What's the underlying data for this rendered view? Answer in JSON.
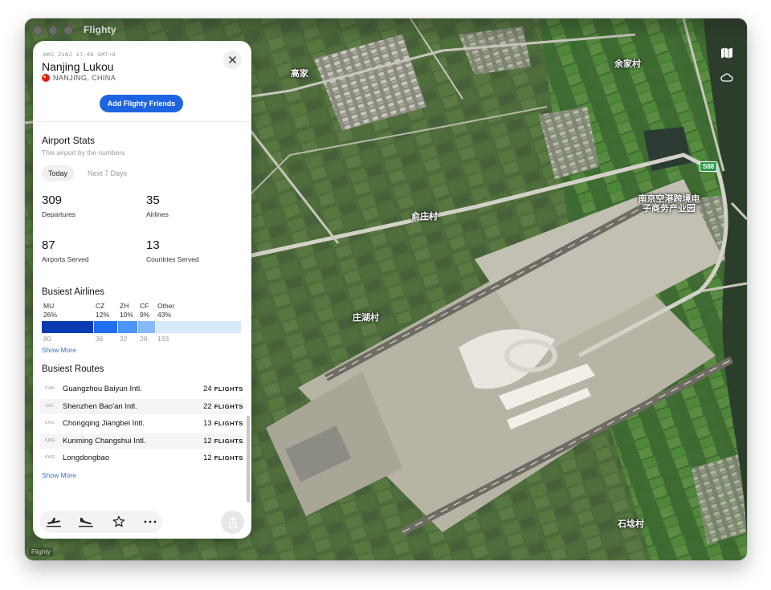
{
  "window": {
    "app_title": "Flighty"
  },
  "map": {
    "labels": {
      "gaojia": "高家",
      "yujiacun": "余家村",
      "shengchengcun": "俞庄村",
      "zhuanghucun": "庄湖村",
      "shixiancun": "石埝村",
      "port_park": "南京空港跨境电子商务产业园",
      "highway": "S88"
    },
    "watermark": "Flighty"
  },
  "panel": {
    "codes": "NKG  ZSNJ  17:08 GMT+8",
    "airport_name": "Nanjing Lukou",
    "city": "NANJING, CHINA",
    "friends_button": "Add Flighty Friends",
    "stats": {
      "title": "Airport Stats",
      "subtitle": "This airport by the numbers",
      "tabs": [
        "Today",
        "Next 7 Days"
      ],
      "departures": {
        "value": "309",
        "label": "Departures"
      },
      "airlines": {
        "value": "35",
        "label": "Airlines"
      },
      "airports_served": {
        "value": "87",
        "label": "Airports Served"
      },
      "countries_served": {
        "value": "13",
        "label": "Countries Served"
      }
    },
    "busiest_airlines": {
      "title": "Busiest Airlines",
      "items": [
        {
          "code": "MU",
          "pct": "26%",
          "count": "80",
          "color": "#0a3bb0"
        },
        {
          "code": "CZ",
          "pct": "12%",
          "count": "36",
          "color": "#1f6ff0"
        },
        {
          "code": "ZH",
          "pct": "10%",
          "count": "32",
          "color": "#4a95f6"
        },
        {
          "code": "CF",
          "pct": "9%",
          "count": "28",
          "color": "#84baf8"
        },
        {
          "code": "Other",
          "pct": "43%",
          "count": "133",
          "color": "#d8e9fc"
        }
      ],
      "show_more": "Show More"
    },
    "busiest_routes": {
      "title": "Busiest Routes",
      "items": [
        {
          "code": "CAN",
          "name": "Guangzhou Baiyun Intl.",
          "count": "24",
          "unit": "FLIGHTS"
        },
        {
          "code": "SZX",
          "name": "Shenzhen Bao'an Intl.",
          "count": "22",
          "unit": "FLIGHTS"
        },
        {
          "code": "CKG",
          "name": "Chongqing Jiangbei Intl.",
          "count": "13",
          "unit": "FLIGHTS"
        },
        {
          "code": "KMG",
          "name": "Kunming Changshui Intl.",
          "count": "12",
          "unit": "FLIGHTS"
        },
        {
          "code": "KWE",
          "name": "Longdongbao",
          "count": "12",
          "unit": "FLIGHTS"
        }
      ],
      "show_more": "Show More"
    }
  }
}
